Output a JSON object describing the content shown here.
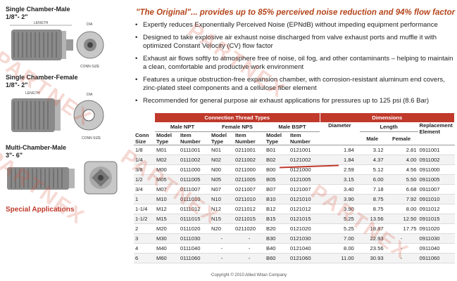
{
  "sidebar": {
    "products": [
      {
        "title": "Single Chamber-Male",
        "range": "1/8\"- 2\""
      },
      {
        "title": "Single Chamber-Female",
        "range": "1/8\"- 2\""
      },
      {
        "title": "Multi-Chamber-Male",
        "range": "3\"- 6\""
      }
    ],
    "diagram_labels": {
      "length": "LENGTH",
      "dia": "DIA",
      "conn": "CONN SIZE"
    },
    "special": "Special Applications"
  },
  "heading": "\"The Original\"... provides up to 85% perceived noise reduction and 94% flow factor",
  "bullets": [
    "Expertly reduces Exponentially Perceived Noise (EPNdB) without impeding equipment performance",
    "Designed to take explosive air exhaust noise discharged from valve exhaust ports and muffle it with optimized Constant Velocity (CV) flow factor",
    "Exhaust air flows softly to atmosphere free of noise, oil fog, and other contaminants – helping to maintain a clean, comfortable and productive work environment",
    "Features a unique obstruction-free expansion chamber, with corrosion-resistant aluminum end covers, zinc-plated steel components and a cellulose fiber element",
    "Recommended for general purpose air exhaust applications for pressures up to 125 psi (8.6 Bar)"
  ],
  "table": {
    "group_headers": {
      "connection": "Connection Thread Types",
      "dimensions": "Dimensions"
    },
    "sub_headers": {
      "conn_size": "Conn Size",
      "npt": "Male NPT",
      "nps": "Female NPS",
      "bspt": "Male BSPT",
      "diameter": "Diameter",
      "length": "Length",
      "replacement": "Replacement Element"
    },
    "col_headers": {
      "model_type": "Model Type",
      "item_number": "Item Number",
      "male": "Male",
      "female": "Female"
    },
    "rows": [
      [
        "1/8",
        "M01",
        "0111001",
        "N01",
        "0211001",
        "B01",
        "0121001",
        "1.84",
        "3.12",
        "2.81",
        "0911001"
      ],
      [
        "1/4",
        "M02",
        "0111002",
        "N02",
        "0211002",
        "B02",
        "0121002",
        "1.84",
        "4.37",
        "4.00",
        "0911002"
      ],
      [
        "3/8",
        "M00",
        "0111000",
        "N00",
        "0211000",
        "B00",
        "0121000",
        "2.59",
        "5.12",
        "4.56",
        "0911000"
      ],
      [
        "1/2",
        "M05",
        "0111005",
        "N05",
        "0211005",
        "B05",
        "0121005",
        "3.15",
        "6.00",
        "5.50",
        "0911005"
      ],
      [
        "3/4",
        "M07",
        "0111007",
        "N07",
        "0211007",
        "B07",
        "0121007",
        "3.40",
        "7.18",
        "6.68",
        "0911007"
      ],
      [
        "1",
        "M10",
        "0111010",
        "N10",
        "0211010",
        "B10",
        "0121010",
        "3.90",
        "8.75",
        "7.92",
        "0911010"
      ],
      [
        "1-1/4",
        "M12",
        "0111012",
        "N12",
        "0211012",
        "B12",
        "0121012",
        "3.90",
        "8.75",
        "8.00",
        "0911012"
      ],
      [
        "1-1/2",
        "M15",
        "0111015",
        "N15",
        "0211015",
        "B15",
        "0121015",
        "5.25",
        "13.56",
        "12.50",
        "0911015"
      ],
      [
        "2",
        "M20",
        "0111020",
        "N20",
        "0211020",
        "B20",
        "0121020",
        "5.25",
        "18.87",
        "17.75",
        "0911020"
      ],
      [
        "3",
        "M30",
        "0111030",
        "-",
        "-",
        "B30",
        "0121030",
        "7.00",
        "22.93",
        "-",
        "0911030"
      ],
      [
        "4",
        "M40",
        "0111040",
        "-",
        "-",
        "B40",
        "0121040",
        "8.00",
        "23.56",
        "-",
        "0911040"
      ],
      [
        "6",
        "M60",
        "0111060",
        "-",
        "-",
        "B60",
        "0121060",
        "11.00",
        "30.93",
        "-",
        "0911060"
      ]
    ]
  },
  "copyright": "Copyright © 2010 Allied Witan Company",
  "watermark": "PARTNEX",
  "colors": {
    "accent": "#c0392b",
    "heading": "#b5451b"
  }
}
